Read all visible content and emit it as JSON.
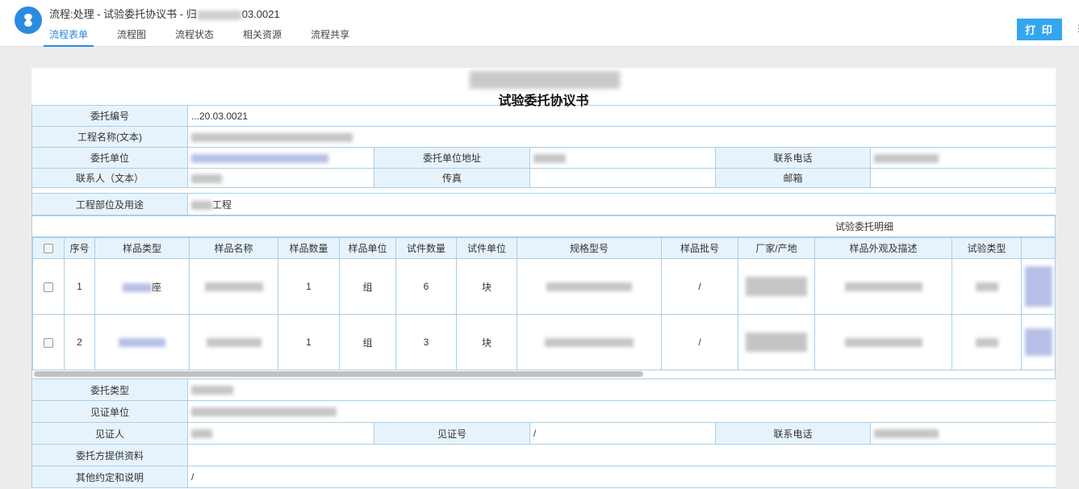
{
  "header": {
    "title_prefix": "流程:处理 - 试验委托协议书 - 归",
    "title_suffix": "03.0021",
    "tabs": [
      "流程表单",
      "流程图",
      "流程状态",
      "相关资源",
      "流程共享"
    ],
    "print_label": "打 印",
    "more_glyph": "⋮"
  },
  "form": {
    "title": "试验委托协议书",
    "rows": {
      "commission_no": {
        "label": "委托编号",
        "value": "...20.03.0021"
      },
      "project_name": {
        "label": "工程名称(文本)"
      },
      "client_unit": {
        "label": "委托单位"
      },
      "client_address": {
        "label": "委托单位地址"
      },
      "phone": {
        "label": "联系电话"
      },
      "contact": {
        "label": "联系人（文本）"
      },
      "fax": {
        "label": "传真"
      },
      "email": {
        "label": "邮箱"
      },
      "project_part": {
        "label": "工程部位及用途",
        "value_suffix": "工程"
      }
    },
    "sample_detail": {
      "title": "试验委托明细",
      "columns": [
        "序号",
        "样品类型",
        "样品名称",
        "样品数量",
        "样品单位",
        "试件数量",
        "试件单位",
        "规格型号",
        "样品批号",
        "厂家/产地",
        "样品外观及描述",
        "试验类型"
      ],
      "rows": [
        {
          "no": "1",
          "type_suffix": "座",
          "qty": "1",
          "unit": "组",
          "test_qty": "6",
          "test_unit": "块",
          "batch": "/"
        },
        {
          "no": "2",
          "qty": "1",
          "unit": "组",
          "test_qty": "3",
          "test_unit": "块",
          "batch": "/"
        }
      ]
    },
    "bottom": {
      "commission_type": {
        "label": "委托类型"
      },
      "witness_unit": {
        "label": "见证单位"
      },
      "witness": {
        "label": "见证人"
      },
      "witness_no": {
        "label": "见证号",
        "value": "/"
      },
      "phone2": {
        "label": "联系电话"
      },
      "materials": {
        "label": "委托方提供资料"
      },
      "other": {
        "label": "其他约定和说明",
        "value": "/"
      }
    }
  },
  "colors": {
    "accent": "#2a8be0",
    "print_button": "#34a6f0",
    "label_bg": "#e7f3fc",
    "border": "#a9cfea"
  },
  "icons": {
    "logo": "app-logo-icon",
    "more": "more-vertical-icon"
  }
}
